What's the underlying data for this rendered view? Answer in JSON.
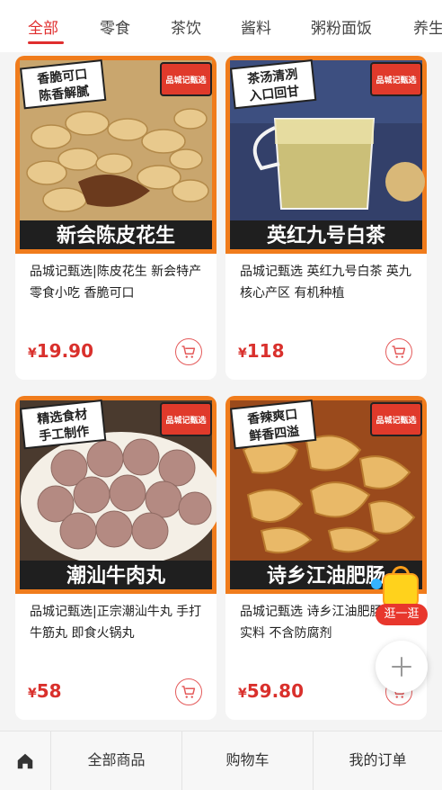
{
  "tabs": [
    "全部",
    "零食",
    "茶饮",
    "酱料",
    "粥粉面饭",
    "养生"
  ],
  "products": [
    {
      "poster_text": "新会陈皮花生",
      "tag_line1": "香脆可口",
      "tag_line2": "陈香解腻",
      "badge": "品城记甄选",
      "title": "品城记甄选|陈皮花生 新会特产零食小吃 香脆可口",
      "currency": "¥",
      "price": "19.90"
    },
    {
      "poster_text": "英红九号白茶",
      "tag_line1": "茶汤清冽",
      "tag_line2": "入口回甘",
      "badge": "品城记甄选",
      "title": "品城记甄选 英红九号白茶 英九核心产区 有机种植",
      "currency": "¥",
      "price": "118"
    },
    {
      "poster_text": "潮汕牛肉丸",
      "tag_line1": "精选食材",
      "tag_line2": "手工制作",
      "badge": "品城记甄选",
      "title": "品城记甄选|正宗潮汕牛丸 手打牛筋丸 即食火锅丸",
      "currency": "¥",
      "price": "58"
    },
    {
      "poster_text": "诗乡江油肥肠",
      "tag_line1": "香辣爽口",
      "tag_line2": "鲜香四溢",
      "badge": "品城记甄选",
      "title": "品城记甄选 诗乡江油肥肠 真材实料 不含防腐剂",
      "currency": "¥",
      "price": "59.80"
    }
  ],
  "float_promo_label": "逛一逛",
  "bottom_nav": {
    "all_products": "全部商品",
    "cart": "购物车",
    "my_orders": "我的订单"
  },
  "colors": {
    "accent": "#e02e2e",
    "price": "#d9302c",
    "poster_orange": "#f07c1c"
  },
  "icons": [
    "home-icon",
    "cart-icon",
    "plus-icon",
    "shopping-bag-icon"
  ]
}
